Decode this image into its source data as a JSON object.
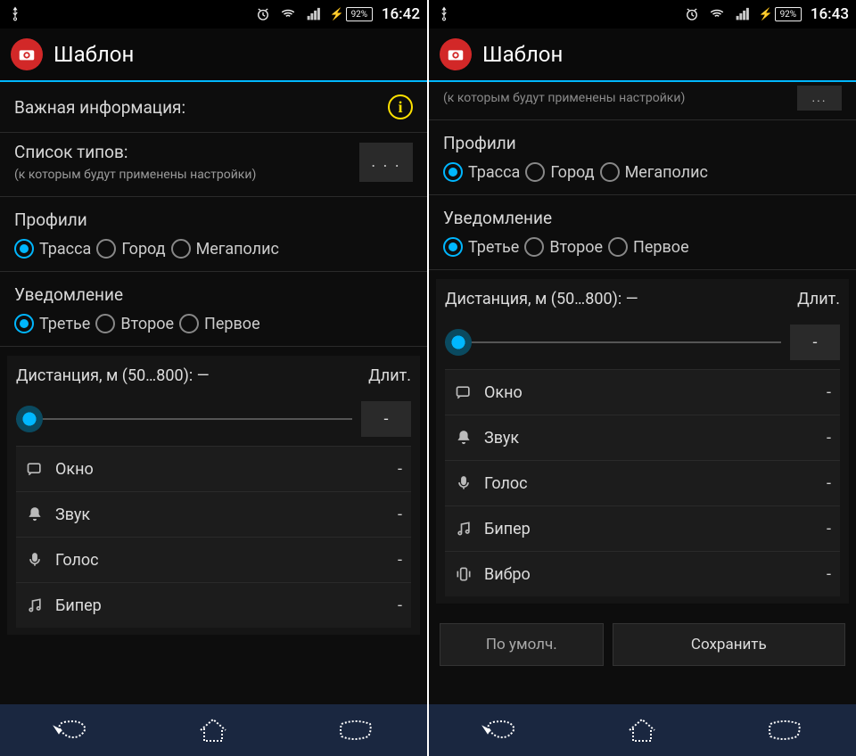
{
  "screens": [
    {
      "statusbar": {
        "battery": "92%",
        "time": "16:42"
      },
      "appbar": {
        "title": "Шаблон"
      },
      "section_info": {
        "title": "Важная информация:"
      },
      "type_list": {
        "title": "Список типов:",
        "subtitle": "(к которым будут применены настройки)",
        "btn": ". . ."
      },
      "profiles": {
        "label": "Профили",
        "options": [
          "Трасса",
          "Город",
          "Мегаполис"
        ],
        "selected": 0
      },
      "notification": {
        "label": "Уведомление",
        "options": [
          "Третье",
          "Второе",
          "Первое"
        ],
        "selected": 0
      },
      "distance": {
        "label": "Дистанция, м (50…800): —",
        "dur_label": "Длит.",
        "dur_value": "-",
        "items": [
          {
            "icon": "window",
            "label": "Окно",
            "value": "-"
          },
          {
            "icon": "bell",
            "label": "Звук",
            "value": "-"
          },
          {
            "icon": "mic",
            "label": "Голос",
            "value": "-"
          },
          {
            "icon": "music",
            "label": "Бипер",
            "value": "-"
          }
        ]
      }
    },
    {
      "statusbar": {
        "battery": "92%",
        "time": "16:43"
      },
      "appbar": {
        "title": "Шаблон"
      },
      "partial_row": {
        "text": "(к которым будут применены настройки)"
      },
      "profiles": {
        "label": "Профили",
        "options": [
          "Трасса",
          "Город",
          "Мегаполис"
        ],
        "selected": 0
      },
      "notification": {
        "label": "Уведомление",
        "options": [
          "Третье",
          "Второе",
          "Первое"
        ],
        "selected": 0
      },
      "distance": {
        "label": "Дистанция, м (50…800): —",
        "dur_label": "Длит.",
        "dur_value": "-",
        "items": [
          {
            "icon": "window",
            "label": "Окно",
            "value": "-"
          },
          {
            "icon": "bell",
            "label": "Звук",
            "value": "-"
          },
          {
            "icon": "mic",
            "label": "Голос",
            "value": "-"
          },
          {
            "icon": "music",
            "label": "Бипер",
            "value": "-"
          },
          {
            "icon": "vibrate",
            "label": "Вибро",
            "value": "-"
          }
        ]
      },
      "buttons": {
        "default": "По умолч.",
        "save": "Сохранить"
      }
    }
  ]
}
